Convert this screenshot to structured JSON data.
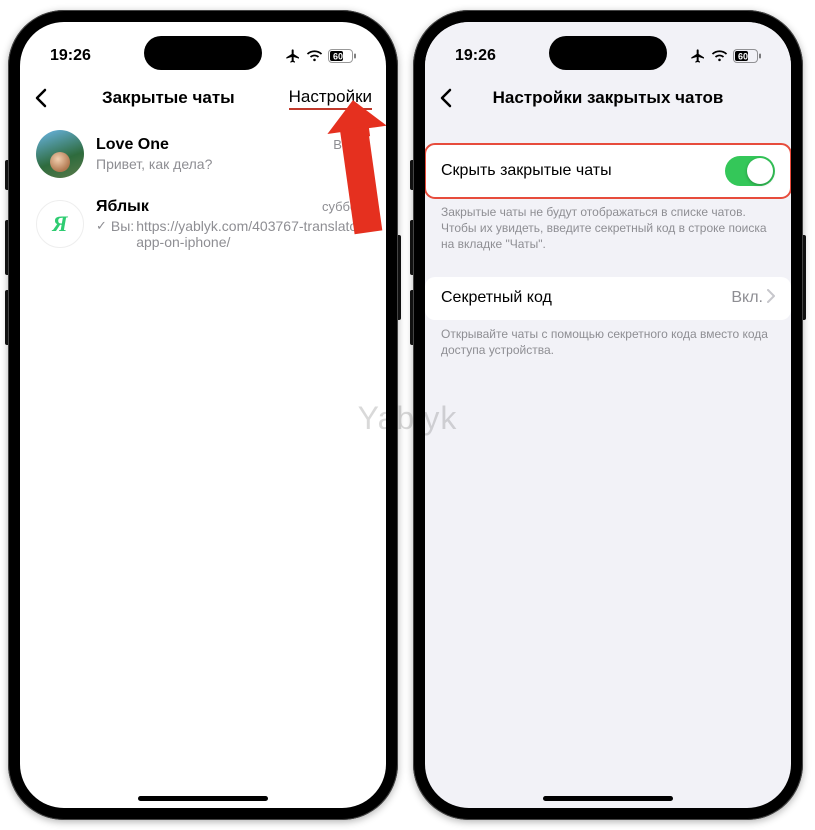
{
  "status": {
    "time": "19:26",
    "battery": "60"
  },
  "left": {
    "title": "Закрытые чаты",
    "action": "Настройки",
    "chats": [
      {
        "name": "Love One",
        "message": "Привет, как дела?",
        "time": "Вчера",
        "avatar": "image"
      },
      {
        "name": "Яблык",
        "prefix": "Вы:",
        "message": "https://yablyk.com/403767-translator-app-on-iphone/",
        "time": "суббота",
        "avatar": "Я"
      }
    ]
  },
  "right": {
    "title": "Настройки закрытых чатов",
    "hide": {
      "label": "Скрыть закрытые чаты",
      "note": "Закрытые чаты не будут отображаться в списке чатов. Чтобы их увидеть, введите секретный код в строке поиска на вкладке \"Чаты\"."
    },
    "secret": {
      "label": "Секретный код",
      "value": "Вкл.",
      "note": "Открывайте чаты с помощью секретного кода вместо кода доступа устройства."
    }
  },
  "watermark": "Yablyk"
}
